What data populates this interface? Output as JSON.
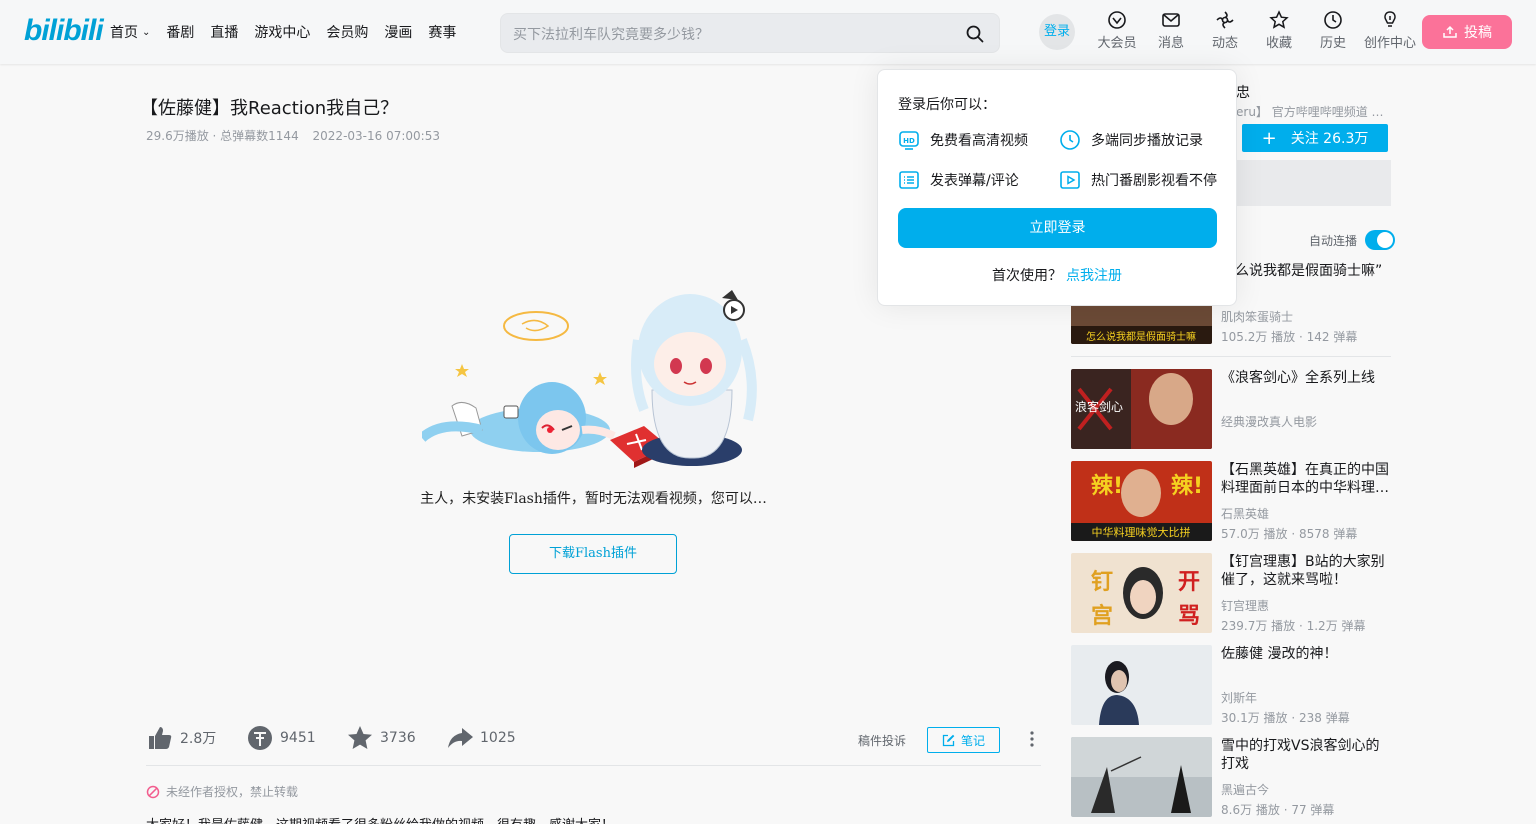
{
  "header": {
    "logo": "bilibili",
    "nav": [
      {
        "label": "首页",
        "has_dropdown": true,
        "icon": "chevron-down-icon"
      },
      {
        "label": "番剧"
      },
      {
        "label": "直播"
      },
      {
        "label": "游戏中心"
      },
      {
        "label": "会员购"
      },
      {
        "label": "漫画"
      },
      {
        "label": "赛事"
      }
    ],
    "search_placeholder": "买下法拉利车队究竟要多少钱？",
    "login_label": "登录",
    "right_icons": [
      {
        "label": "大会员",
        "icon": "vip-icon"
      },
      {
        "label": "消息",
        "icon": "message-icon"
      },
      {
        "label": "动态",
        "icon": "dynamic-icon"
      },
      {
        "label": "收藏",
        "icon": "star-icon"
      },
      {
        "label": "历史",
        "icon": "history-icon"
      },
      {
        "label": "创作中心",
        "icon": "creator-icon"
      }
    ],
    "upload_label": "投稿",
    "accent": "#00aeec",
    "upload_color": "#fb7299"
  },
  "video": {
    "title": "【佐藤健】我Reaction我自己？",
    "views": "29.6万播放 · 总弹幕数1144",
    "date": "2022-03-16 07:00:53",
    "flash_message": "主人，未安装Flash插件，暂时无法观看视频，您可以…",
    "flash_button": "下载Flash插件",
    "toolbar": {
      "like": "2.8万",
      "coin": "9451",
      "fav": "3736",
      "share": "1025",
      "report": "稿件投诉",
      "note": "笔记"
    },
    "copyright": "未经作者授权，禁止转载",
    "description": "大家好！我是佐藤健，这期视频看了很多粉丝给我做的视频，很有趣，感谢大家！"
  },
  "sidebar": {
    "up_name": "忠",
    "up_desc": "eru】 官方哔哩哔哩频道 …",
    "follow_label": "关注 26.3万",
    "autoplay_label": "自动连播",
    "autoplay_on": true,
    "recommendations": [
      {
        "title": "怎么说我都是假面骑士嘛”",
        "up": "肌肉笨蛋骑士",
        "stat": "105.2万 播放 · 142 弹幕",
        "thumb_text": "怎么说我都是假面骑士嘛"
      },
      {
        "title": "《浪客剑心》全系列上线",
        "up": "经典漫改真人电影",
        "stat": "",
        "thumb_text": "浪客剑心"
      },
      {
        "title": "【石黑英雄】在真正的中国料理面前日本的中华料理…",
        "up": "石黑英雄",
        "stat": "57.0万 播放 · 8578 弹幕",
        "thumb_text": "中华料理味觉大比拼"
      },
      {
        "title": "【钉宫理惠】B站的大家别催了，这就来骂啦！",
        "up": "钉宫理惠",
        "stat": "239.7万 播放 · 1.2万 弹幕",
        "thumb_text": "钉宫 开骂"
      },
      {
        "title": "佐藤健 漫改的神！",
        "up": "刘斯年",
        "stat": "30.1万 播放 · 238 弹幕",
        "thumb_text": ""
      },
      {
        "title": "雪中的打戏VS浪客剑心的打戏",
        "up": "黑遍古今",
        "stat": "8.6万 播放 · 77 弹幕",
        "thumb_text": ""
      }
    ]
  },
  "login_popup": {
    "title": "登录后你可以：",
    "perks": [
      {
        "label": "免费看高清视频",
        "icon": "hd-icon"
      },
      {
        "label": "多端同步播放记录",
        "icon": "clock-icon"
      },
      {
        "label": "发表弹幕/评论",
        "icon": "comment-list-icon"
      },
      {
        "label": "热门番剧影视看不停",
        "icon": "tv-play-icon"
      }
    ],
    "login_button": "立即登录",
    "first_time": "首次使用？",
    "register_link": "点我注册"
  }
}
